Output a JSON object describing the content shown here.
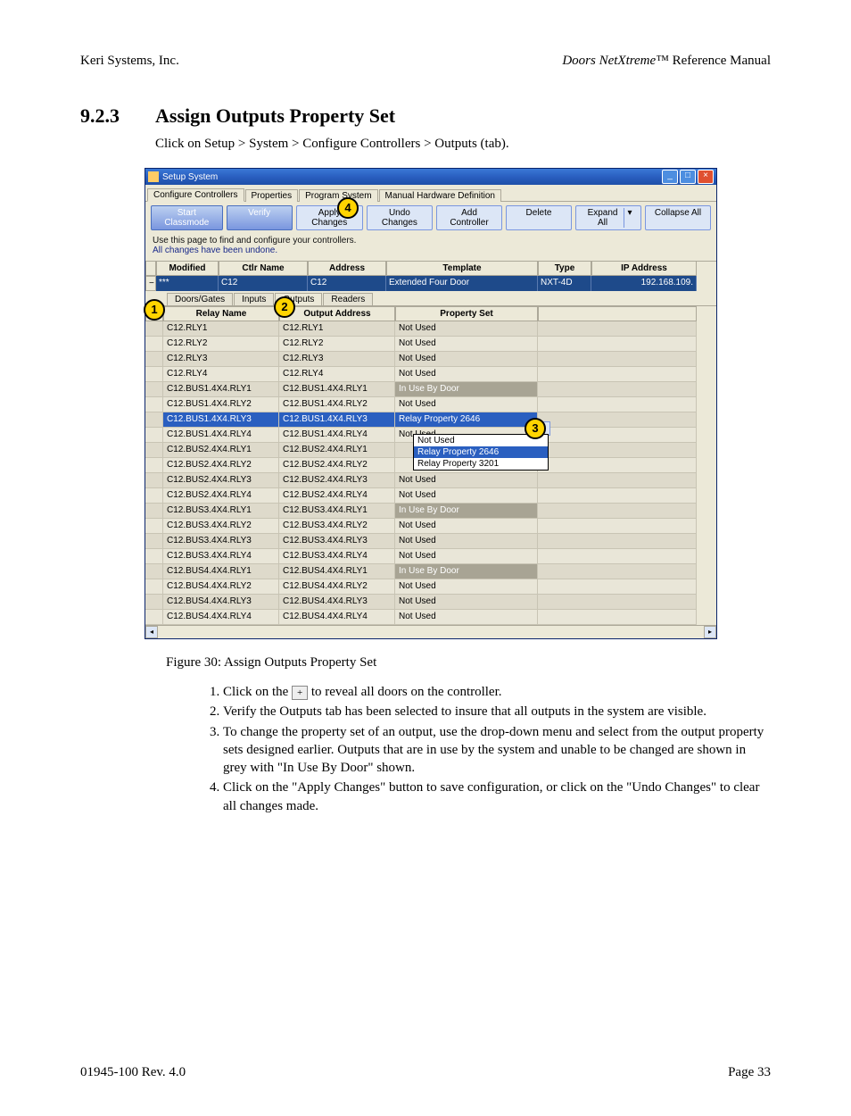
{
  "header": {
    "company": "Keri Systems, Inc.",
    "product": "Doors NetXtreme",
    "tm": "™",
    "manual": " Reference Manual"
  },
  "section": {
    "number": "9.2.3",
    "title": "Assign Outputs Property Set",
    "intro": "Click on Setup > System > Configure Controllers > Outputs (tab)."
  },
  "window": {
    "title": "Setup System",
    "top_tabs": [
      "Configure Controllers",
      "Properties",
      "Program System",
      "Manual Hardware Definition"
    ],
    "toolbar": {
      "start": "Start Classmode",
      "verify": "Verify",
      "apply": "Apply Changes",
      "undo": "Undo Changes",
      "add": "Add Controller",
      "del": "Delete",
      "expand": "Expand All",
      "collapse": "Collapse All"
    },
    "hint1": "Use this page to find and configure your controllers.",
    "hint2": "All changes have been undone.",
    "grid_headers": {
      "modified": "Modified",
      "ctlr": "Ctlr Name",
      "address": "Address",
      "template": "Template",
      "type": "Type",
      "ip": "IP Address"
    },
    "controller": {
      "exp": "−",
      "modified": "***",
      "name": "C12",
      "address": "C12",
      "template": "Extended Four Door",
      "type": "NXT-4D",
      "ip": "192.168.109."
    },
    "sub_tabs": [
      "Doors/Gates",
      "Inputs",
      "Outputs",
      "Readers"
    ],
    "relay_headers": {
      "name": "Relay Name",
      "addr": "Output Address",
      "pset": "Property Set"
    },
    "rows": [
      {
        "name": "C12.RLY1",
        "addr": "C12.RLY1",
        "pset": "Not Used",
        "state": ""
      },
      {
        "name": "C12.RLY2",
        "addr": "C12.RLY2",
        "pset": "Not Used",
        "state": ""
      },
      {
        "name": "C12.RLY3",
        "addr": "C12.RLY3",
        "pset": "Not Used",
        "state": ""
      },
      {
        "name": "C12.RLY4",
        "addr": "C12.RLY4",
        "pset": "Not Used",
        "state": ""
      },
      {
        "name": "C12.BUS1.4X4.RLY1",
        "addr": "C12.BUS1.4X4.RLY1",
        "pset": "In Use By Door",
        "state": "inuse"
      },
      {
        "name": "C12.BUS1.4X4.RLY2",
        "addr": "C12.BUS1.4X4.RLY2",
        "pset": "Not Used",
        "state": ""
      },
      {
        "name": "C12.BUS1.4X4.RLY3",
        "addr": "C12.BUS1.4X4.RLY3",
        "pset": "Relay Property 2646",
        "state": "sel"
      },
      {
        "name": "C12.BUS1.4X4.RLY4",
        "addr": "C12.BUS1.4X4.RLY4",
        "pset": "Not Used",
        "state": ""
      },
      {
        "name": "C12.BUS2.4X4.RLY1",
        "addr": "C12.BUS2.4X4.RLY1",
        "pset": "Relay Property 2646",
        "state": "dd"
      },
      {
        "name": "C12.BUS2.4X4.RLY2",
        "addr": "C12.BUS2.4X4.RLY2",
        "pset": "Relay Property 3201",
        "state": "dd2"
      },
      {
        "name": "C12.BUS2.4X4.RLY3",
        "addr": "C12.BUS2.4X4.RLY3",
        "pset": "Not Used",
        "state": ""
      },
      {
        "name": "C12.BUS2.4X4.RLY4",
        "addr": "C12.BUS2.4X4.RLY4",
        "pset": "Not Used",
        "state": ""
      },
      {
        "name": "C12.BUS3.4X4.RLY1",
        "addr": "C12.BUS3.4X4.RLY1",
        "pset": "In Use By Door",
        "state": "inuse"
      },
      {
        "name": "C12.BUS3.4X4.RLY2",
        "addr": "C12.BUS3.4X4.RLY2",
        "pset": "Not Used",
        "state": ""
      },
      {
        "name": "C12.BUS3.4X4.RLY3",
        "addr": "C12.BUS3.4X4.RLY3",
        "pset": "Not Used",
        "state": ""
      },
      {
        "name": "C12.BUS3.4X4.RLY4",
        "addr": "C12.BUS3.4X4.RLY4",
        "pset": "Not Used",
        "state": ""
      },
      {
        "name": "C12.BUS4.4X4.RLY1",
        "addr": "C12.BUS4.4X4.RLY1",
        "pset": "In Use By Door",
        "state": "inuse"
      },
      {
        "name": "C12.BUS4.4X4.RLY2",
        "addr": "C12.BUS4.4X4.RLY2",
        "pset": "Not Used",
        "state": ""
      },
      {
        "name": "C12.BUS4.4X4.RLY3",
        "addr": "C12.BUS4.4X4.RLY3",
        "pset": "Not Used",
        "state": ""
      },
      {
        "name": "C12.BUS4.4X4.RLY4",
        "addr": "C12.BUS4.4X4.RLY4",
        "pset": "Not Used",
        "state": ""
      }
    ],
    "dropdown": {
      "opt0": "Not Used",
      "opt1": "Relay Property 2646",
      "opt2": "Relay Property 3201"
    }
  },
  "figure_caption": "Figure 30: Assign Outputs Property Set",
  "steps": {
    "s1a": "Click on the ",
    "s1b": " to reveal all doors on the controller.",
    "icon": "+",
    "s2": "Verify the Outputs tab has been selected to insure that all outputs in the system are visible.",
    "s3": "To change the property set of an output, use the drop-down menu and select from the output property sets designed earlier. Outputs that are in use by the system and unable to be changed are shown in grey with \"In Use By Door\" shown.",
    "s4": "Click on the \"Apply Changes\" button to save configuration, or click on the \"Undo Changes\" to clear all changes made."
  },
  "footer": {
    "doc": "01945-100  Rev. 4.0",
    "page": "Page 33"
  },
  "anno": {
    "a1": "1",
    "a2": "2",
    "a3": "3",
    "a4": "4"
  }
}
